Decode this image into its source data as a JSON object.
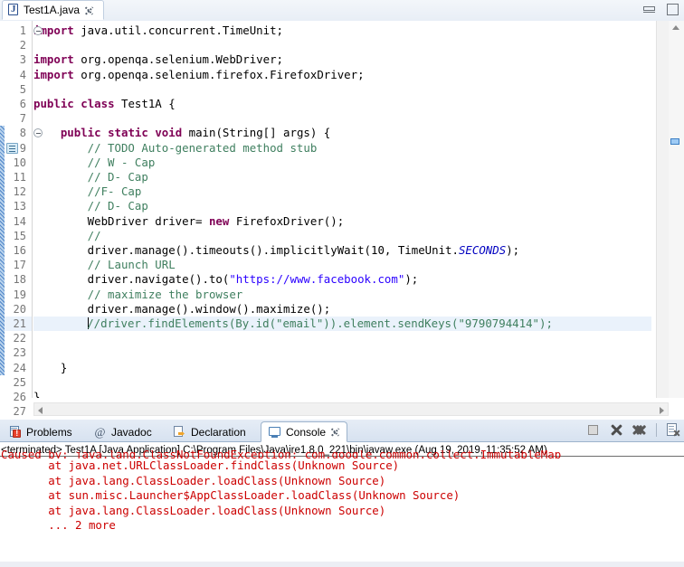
{
  "window": {
    "minimize_label": "Minimize",
    "maximize_label": "Maximize"
  },
  "editor": {
    "tab": {
      "label": "Test1A.java",
      "icon": "java-file-icon",
      "close_label": "Close"
    },
    "lines": [
      {
        "num": "1",
        "fold": true,
        "text": "import java.util.concurrent.TimeUnit;"
      },
      {
        "num": "2",
        "fold": false,
        "text": ""
      },
      {
        "num": "3",
        "fold": false,
        "text": "import org.openqa.selenium.WebDriver;"
      },
      {
        "num": "4",
        "fold": false,
        "text": "import org.openqa.selenium.firefox.FirefoxDriver;"
      },
      {
        "num": "5",
        "fold": false,
        "text": ""
      },
      {
        "num": "6",
        "fold": false,
        "text": "public class Test1A {"
      },
      {
        "num": "7",
        "fold": false,
        "text": ""
      },
      {
        "num": "8",
        "fold": true,
        "text": "    public static void main(String[] args) {"
      },
      {
        "num": "9",
        "fold": false,
        "text": "        // TODO Auto-generated method stub"
      },
      {
        "num": "10",
        "fold": false,
        "text": "        // W - Cap"
      },
      {
        "num": "11",
        "fold": false,
        "text": "        // D- Cap"
      },
      {
        "num": "12",
        "fold": false,
        "text": "        //F- Cap"
      },
      {
        "num": "13",
        "fold": false,
        "text": "        // D- Cap"
      },
      {
        "num": "14",
        "fold": false,
        "text": "        WebDriver driver= new FirefoxDriver();"
      },
      {
        "num": "15",
        "fold": false,
        "text": "        //"
      },
      {
        "num": "16",
        "fold": false,
        "text": "        driver.manage().timeouts().implicitlyWait(10, TimeUnit.SECONDS);"
      },
      {
        "num": "17",
        "fold": false,
        "text": "        // Launch URL"
      },
      {
        "num": "18",
        "fold": false,
        "text": "        driver.navigate().to(\"https://www.facebook.com\");"
      },
      {
        "num": "19",
        "fold": false,
        "text": "        // maximize the browser"
      },
      {
        "num": "20",
        "fold": false,
        "text": "        driver.manage().window().maximize();"
      },
      {
        "num": "21",
        "fold": false,
        "text": "        //driver.findElements(By.id(\"email\")).element.sendKeys(\"9790794414\");"
      },
      {
        "num": "22",
        "fold": false,
        "text": ""
      },
      {
        "num": "23",
        "fold": false,
        "text": ""
      },
      {
        "num": "24",
        "fold": false,
        "text": "    }"
      },
      {
        "num": "25",
        "fold": false,
        "text": ""
      },
      {
        "num": "26",
        "fold": false,
        "text": "}"
      },
      {
        "num": "27",
        "fold": false,
        "text": ""
      }
    ],
    "current_line": "21",
    "todo_marker_line": "9",
    "colors": {
      "keyword": "#7F0055",
      "comment": "#3F7F5F",
      "string": "#2A00FF",
      "static_field": "#0000C0",
      "current_line_bg": "#EAF2FB",
      "change_bar": "#4F85C8"
    }
  },
  "console": {
    "tabs": [
      {
        "label": "Problems",
        "icon": "problems-icon",
        "active": false
      },
      {
        "label": "Javadoc",
        "icon": "at-icon",
        "active": false
      },
      {
        "label": "Declaration",
        "icon": "declaration-icon",
        "active": false
      },
      {
        "label": "Console",
        "icon": "console-icon",
        "active": true
      }
    ],
    "toolbar": [
      {
        "name": "terminate-button",
        "icon": "stop-square-icon"
      },
      {
        "name": "remove-console-button",
        "icon": "close-x-icon"
      },
      {
        "name": "remove-all-consoles-button",
        "icon": "close-all-icon"
      },
      {
        "name": "clear-console-button",
        "icon": "document-clear-icon"
      }
    ],
    "header": "<terminated> Test1A [Java Application] C:\\Program Files\\Java\\jre1.8.0_221\\bin\\javaw.exe (Aug 19, 2019, 11:35:52 AM)",
    "output": [
      "Caused by: java.lang.ClassNotFoundException: com.google.common.collect.ImmutableMap",
      "\tat java.net.URLClassLoader.findClass(Unknown Source)",
      "\tat java.lang.ClassLoader.loadClass(Unknown Source)",
      "\tat sun.misc.Launcher$AppClassLoader.loadClass(Unknown Source)",
      "\tat java.lang.ClassLoader.loadClass(Unknown Source)",
      "\t... 2 more"
    ],
    "output_color": "#CC0000"
  }
}
